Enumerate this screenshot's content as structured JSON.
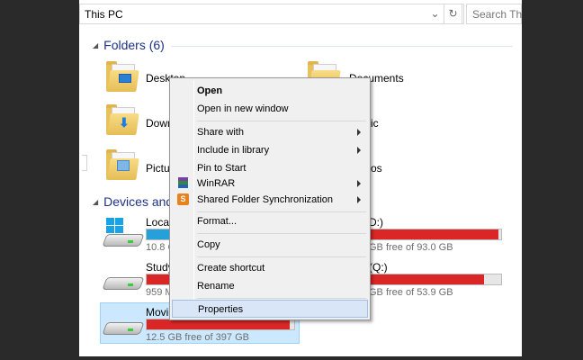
{
  "address": {
    "path": "This PC",
    "search_placeholder": "Search Th..."
  },
  "groups": {
    "folders_title": "Folders (6)",
    "devices_title": "Devices and"
  },
  "folders": [
    {
      "label": "Desktop"
    },
    {
      "label": "Documents"
    },
    {
      "label": "Down"
    },
    {
      "label": "ic"
    },
    {
      "label": "Pictur"
    },
    {
      "label": "os"
    }
  ],
  "drives": [
    {
      "label": "Local",
      "free": "10.8 G",
      "fill_fraction": 1.0,
      "color": "#26a0da"
    },
    {
      "label": "D:)",
      "free": "GB free of 93.0 GB",
      "fill_fraction": 0.98,
      "color": "#da2626"
    },
    {
      "label": "Study",
      "free": "959 M",
      "fill_fraction": 1.0,
      "color": "#da2626"
    },
    {
      "label": "(Q:)",
      "free": "GB free of 53.9 GB",
      "fill_fraction": 0.87,
      "color": "#da2626"
    },
    {
      "label": "Movie",
      "free": "12.5 GB free of 397 GB",
      "fill_fraction": 0.97,
      "color": "#da2626"
    }
  ],
  "context_menu": {
    "items": [
      {
        "label": "Open"
      },
      {
        "label": "Open in new window"
      },
      {
        "label": "Share with"
      },
      {
        "label": "Include in library"
      },
      {
        "label": "Pin to Start"
      },
      {
        "label": "WinRAR"
      },
      {
        "label": "Shared Folder Synchronization"
      },
      {
        "label": "Format..."
      },
      {
        "label": "Copy"
      },
      {
        "label": "Create shortcut"
      },
      {
        "label": "Rename"
      },
      {
        "label": "Properties"
      }
    ]
  },
  "icons": {
    "refresh": "refresh-icon",
    "dropdown": "chevron-down-icon",
    "winrar": "winrar-icon",
    "sync": "shared-folder-sync-icon"
  }
}
